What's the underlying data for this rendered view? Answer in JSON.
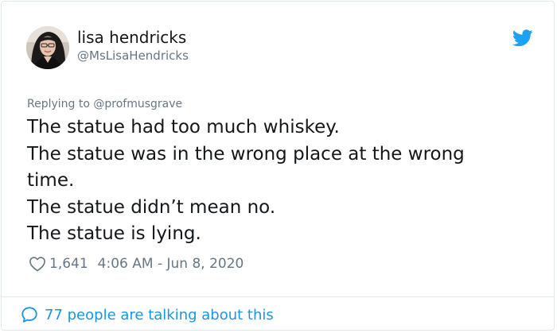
{
  "user": {
    "display_name": "lisa hendricks",
    "handle": "@MsLisaHendricks",
    "avatar_icon": "profile-photo",
    "platform_icon": "twitter-bird-icon"
  },
  "reply": {
    "prefix": "Replying to",
    "to_handle": "@profmusgrave"
  },
  "tweet": {
    "lines": [
      "The statue had too much whiskey.",
      "The statue was in the wrong place at the wrong",
      "time.",
      "The statue didn’t mean no.",
      "The statue is lying."
    ]
  },
  "meta": {
    "likes": "1,641",
    "timestamp": "4:06 AM - Jun 8, 2020"
  },
  "footer": {
    "talking_text": "77 people are talking about this"
  },
  "colors": {
    "text": "#14171a",
    "secondary": "#657786",
    "twitter_blue": "#1da1f2",
    "link_blue": "#1b95e0",
    "border": "#e1e8ed"
  }
}
